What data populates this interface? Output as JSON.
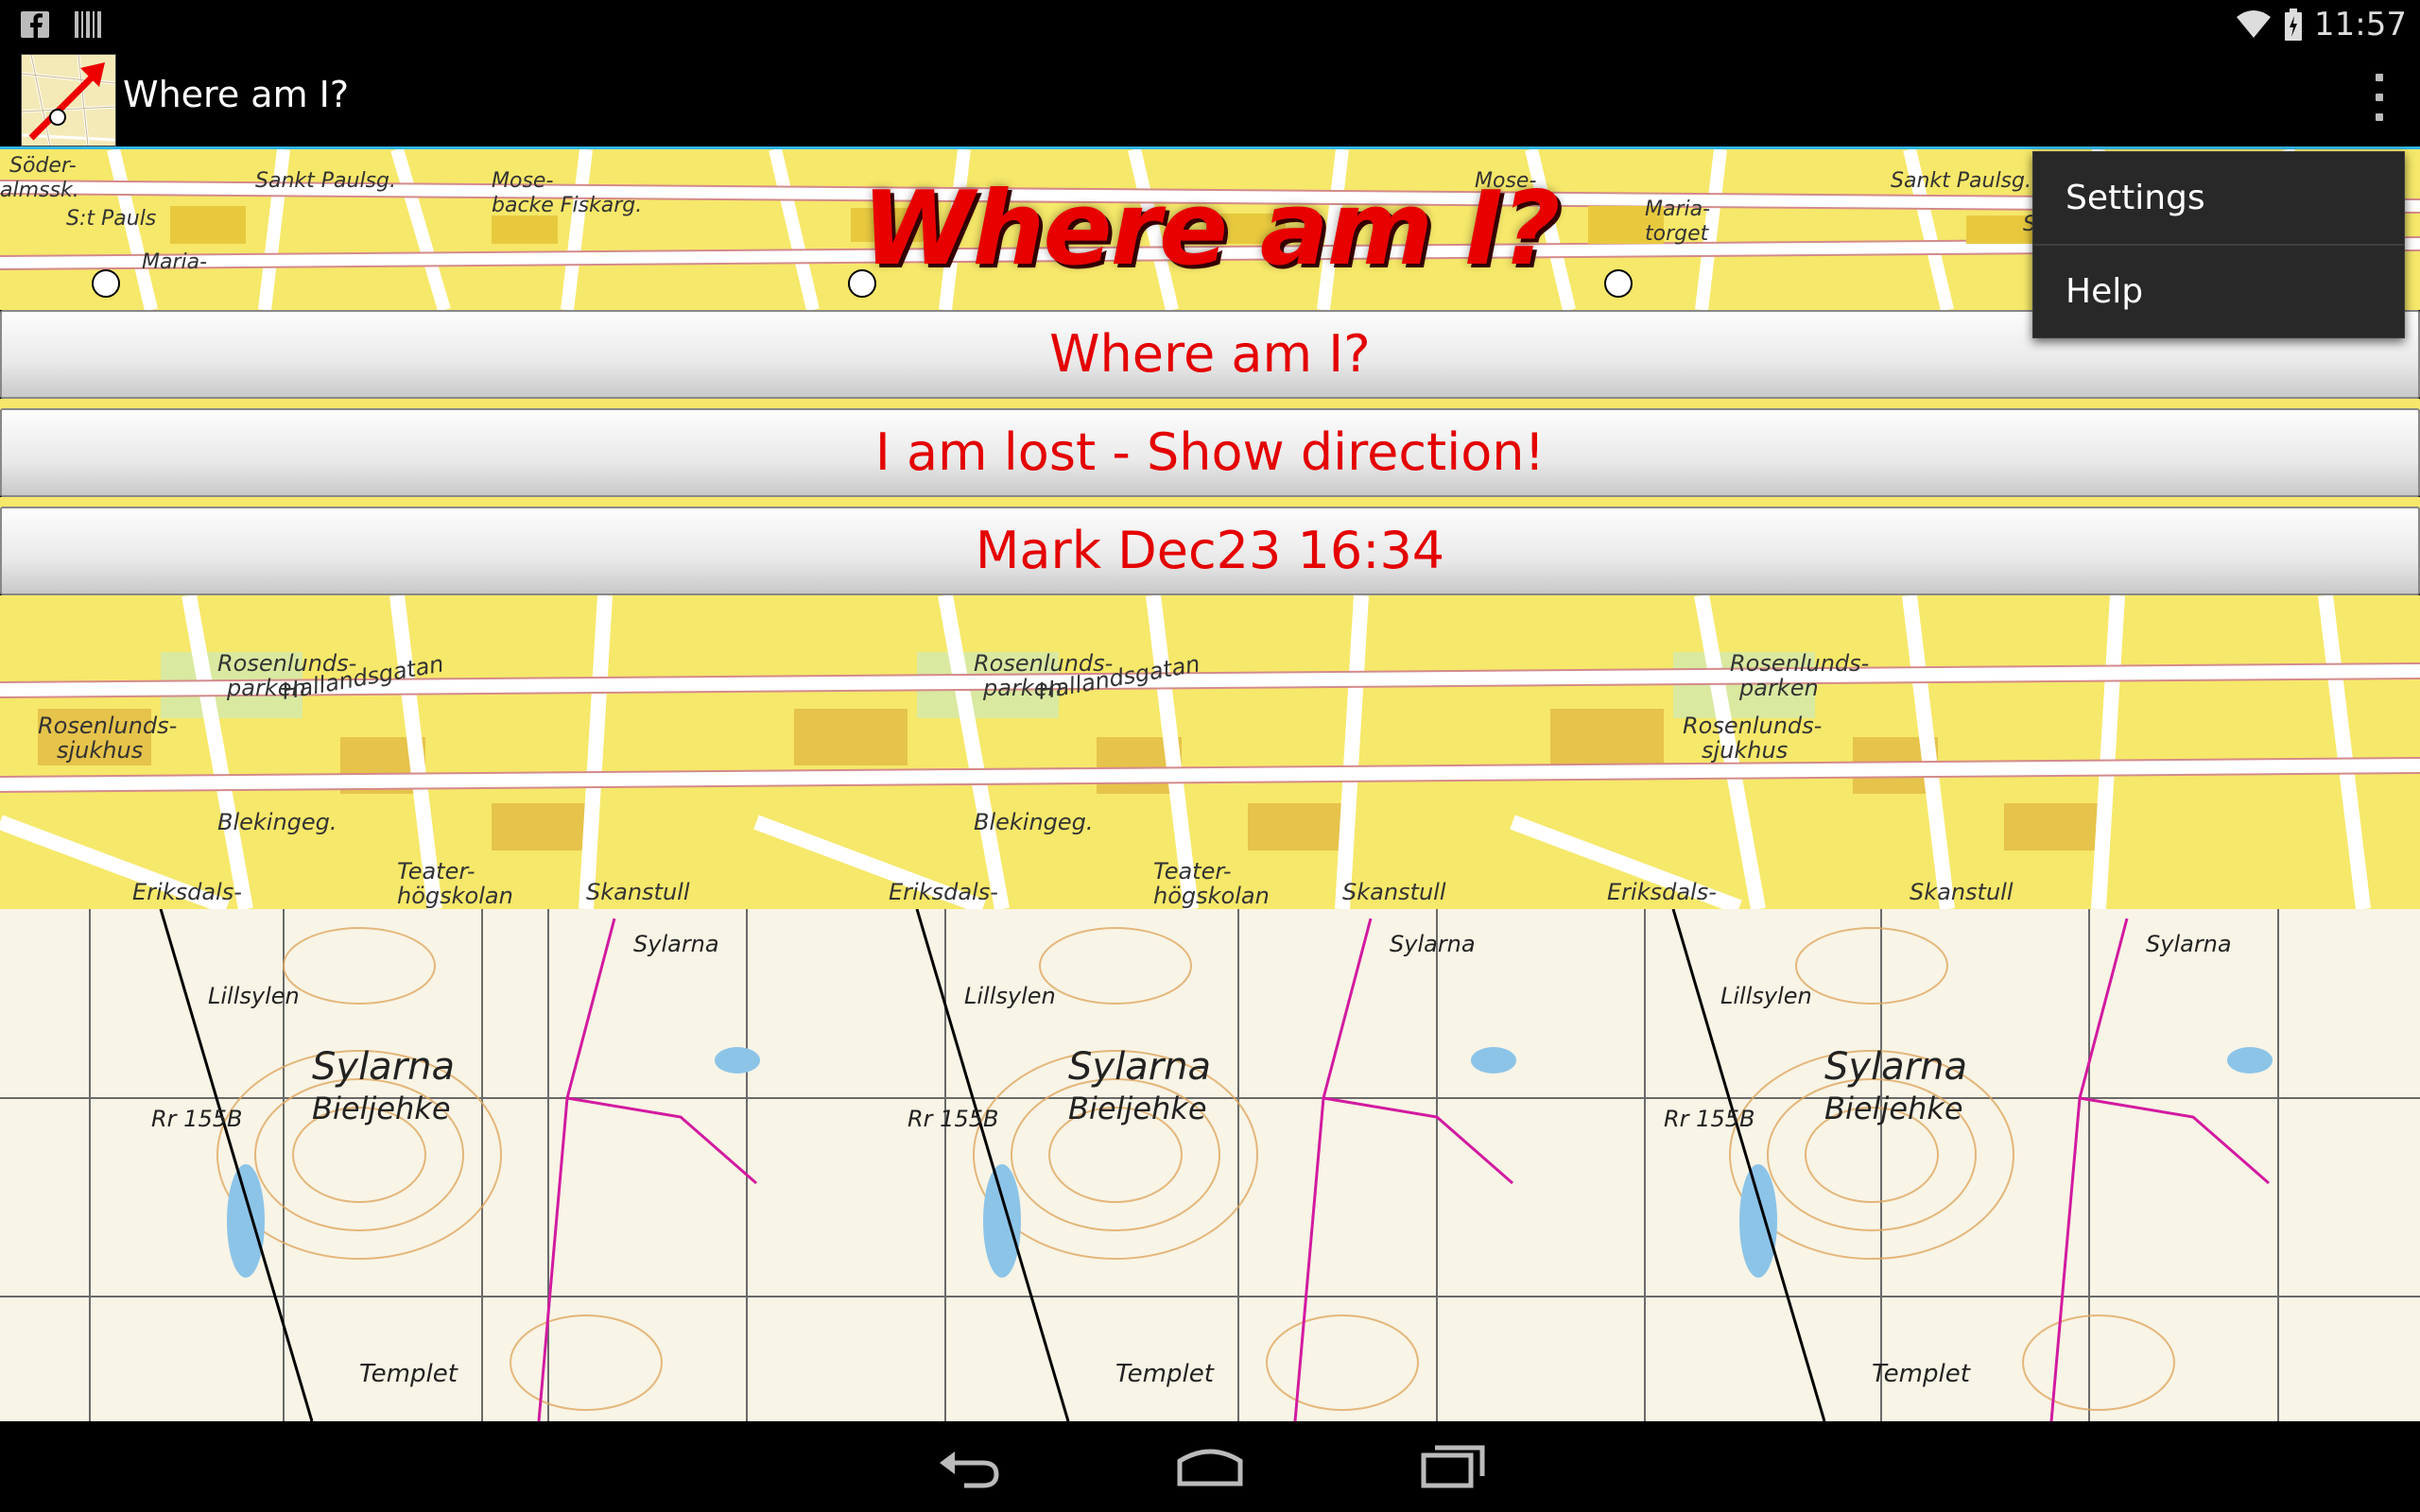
{
  "status_bar": {
    "time": "11:57",
    "icons": [
      "facebook-icon",
      "barcode-icon",
      "wifi-icon",
      "battery-icon"
    ]
  },
  "action_bar": {
    "title": "Where am I?",
    "icons": [
      "app-logo-icon",
      "overflow-menu-icon"
    ],
    "accent_color": "#33b5e5"
  },
  "banner": {
    "title": "Where am I?",
    "color": "#e80000"
  },
  "buttons": [
    {
      "label": "Where am I?"
    },
    {
      "label": "I am lost - Show direction!"
    },
    {
      "label": "Mark Dec23 16:34"
    }
  ],
  "overflow_menu": {
    "items": [
      {
        "label": "Settings"
      },
      {
        "label": "Help"
      }
    ]
  },
  "navigation_bar": {
    "icons": [
      "back-icon",
      "home-icon",
      "recent-apps-icon"
    ]
  },
  "colors": {
    "button_text": "#e40000",
    "map_yellow": "#f6e86a",
    "topo_background": "#f8f4e6"
  }
}
